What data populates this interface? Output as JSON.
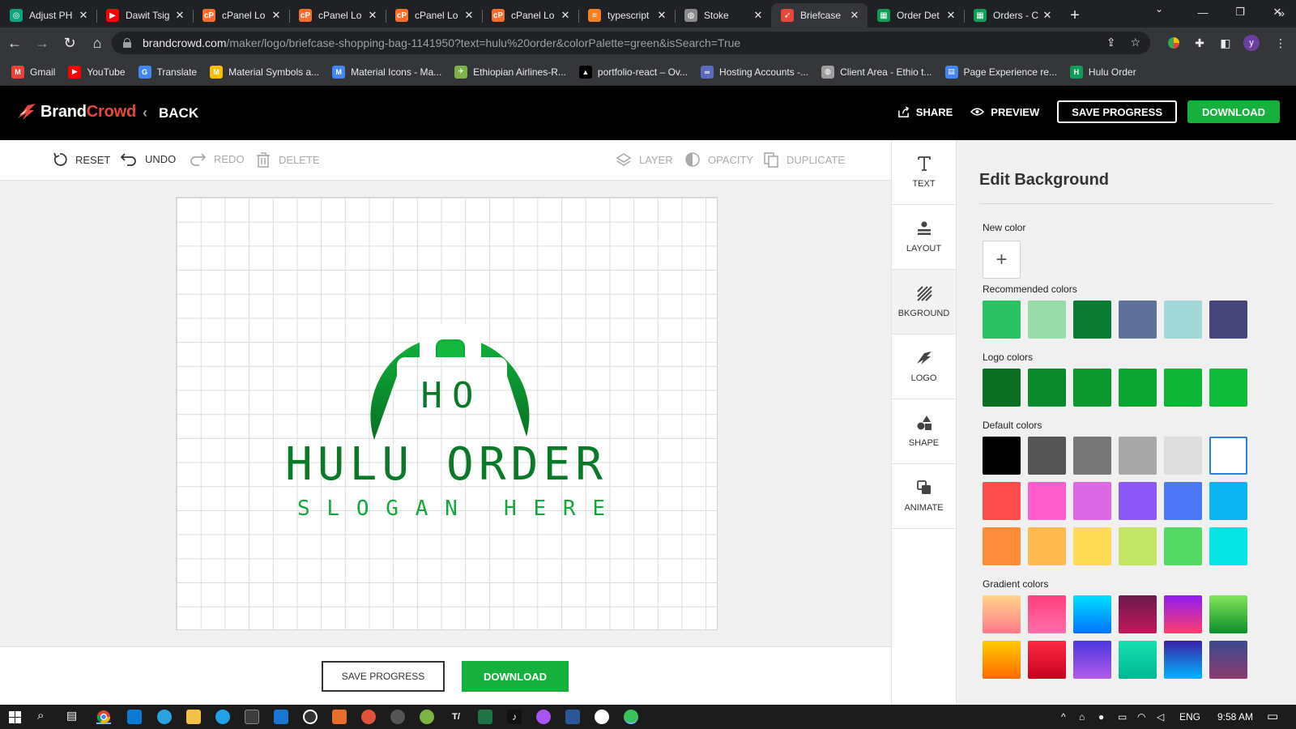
{
  "browser": {
    "tabs": [
      {
        "title": "Adjust PH",
        "color": "#10a37f",
        "glyph": "◎"
      },
      {
        "title": "Dawit Tsig",
        "color": "#ff0000",
        "glyph": "▶"
      },
      {
        "title": "cPanel Lo",
        "color": "#ff6c2c",
        "glyph": "cP"
      },
      {
        "title": "cPanel Lo",
        "color": "#ff6c2c",
        "glyph": "cP"
      },
      {
        "title": "cPanel Lo",
        "color": "#ff6c2c",
        "glyph": "cP"
      },
      {
        "title": "cPanel Lo",
        "color": "#ff6c2c",
        "glyph": "cP"
      },
      {
        "title": "typescript",
        "color": "#f48024",
        "glyph": "≡"
      },
      {
        "title": "Stoke",
        "color": "#8a8a8a",
        "glyph": "◍"
      },
      {
        "title": "Briefcase",
        "color": "#e8463b",
        "glyph": "➶"
      },
      {
        "title": "Order Det",
        "color": "#0f9d58",
        "glyph": "▦"
      },
      {
        "title": "Orders - C",
        "color": "#0f9d58",
        "glyph": "▦"
      }
    ],
    "active_tab_index": 8,
    "url_host": "brandcrowd.com",
    "url_path": "/maker/logo/briefcase-shopping-bag-1141950?text=hulu%20order&colorPalette=green&isSearch=True",
    "profile_initial": "y",
    "bookmarks": [
      {
        "label": "Gmail",
        "color": "#ea4335",
        "glyph": "M"
      },
      {
        "label": "YouTube",
        "color": "#ff0000",
        "glyph": "▶"
      },
      {
        "label": "Translate",
        "color": "#4285f4",
        "glyph": "G"
      },
      {
        "label": "Material Symbols a...",
        "color": "#fbbc04",
        "glyph": "M"
      },
      {
        "label": "Material Icons - Ma...",
        "color": "#4285f4",
        "glyph": "M"
      },
      {
        "label": "Ethiopian Airlines-R...",
        "color": "#7cb342",
        "glyph": "✈"
      },
      {
        "label": "portfolio-react – Ov...",
        "color": "#000000",
        "glyph": "▲"
      },
      {
        "label": "Hosting Accounts -...",
        "color": "#5c6bc0",
        "glyph": "∞"
      },
      {
        "label": "Client Area - Ethio t...",
        "color": "#9e9e9e",
        "glyph": "◍"
      },
      {
        "label": "Page Experience re...",
        "color": "#4285f4",
        "glyph": "▤"
      },
      {
        "label": "Hulu Order",
        "color": "#0f9d58",
        "glyph": "H"
      }
    ]
  },
  "header": {
    "brand_part1": "Brand",
    "brand_part2": "Crowd",
    "back_label": "BACK",
    "share_label": "SHARE",
    "preview_label": "PREVIEW",
    "save_progress_label": "SAVE PROGRESS",
    "download_label": "DOWNLOAD"
  },
  "toolbar": {
    "reset": "RESET",
    "undo": "UNDO",
    "redo": "REDO",
    "delete": "DELETE",
    "layer": "LAYER",
    "opacity": "OPACITY",
    "duplicate": "DUPLICATE"
  },
  "logo": {
    "monogram": "HO",
    "name": "HULU ORDER",
    "slogan": "SLOGAN HERE",
    "primary_color": "#0a7a2a",
    "accent_color": "#12b33e"
  },
  "bottom": {
    "save_progress_label": "SAVE PROGRESS",
    "download_label": "DOWNLOAD"
  },
  "side_tabs": [
    {
      "label": "TEXT",
      "icon": "text-icon"
    },
    {
      "label": "LAYOUT",
      "icon": "layout-icon"
    },
    {
      "label": "BKGROUND",
      "icon": "background-icon"
    },
    {
      "label": "LOGO",
      "icon": "logo-icon"
    },
    {
      "label": "SHAPE",
      "icon": "shape-icon"
    },
    {
      "label": "ANIMATE",
      "icon": "animate-icon"
    }
  ],
  "active_side_tab": "BKGROUND",
  "panel": {
    "title": "Edit Background",
    "new_color_label": "New color",
    "recommended_label": "Recommended colors",
    "recommended": [
      "#2ac265",
      "#98dcaa",
      "#0b7a32",
      "#5f7198",
      "#a3d8d8",
      "#45457a"
    ],
    "logo_colors_label": "Logo colors",
    "logo_colors": [
      "#0b6e22",
      "#0b8a2d",
      "#0c982f",
      "#0ca532",
      "#0db536",
      "#10bb3a"
    ],
    "default_colors_label": "Default colors",
    "default_colors": [
      [
        "#000000",
        "#555555",
        "#777777",
        "#a8a8a8",
        "#dddddd",
        "#ffffff"
      ],
      [
        "#ff4b4b",
        "#ff5ccc",
        "#dc68e5",
        "#8b57f6",
        "#4a76f7",
        "#0db4f4"
      ],
      [
        "#ff8c3a",
        "#ffba4f",
        "#ffdb55",
        "#c3e566",
        "#55d965",
        "#05e3e3"
      ]
    ],
    "selected_default": "#ffffff",
    "gradient_colors_label": "Gradient colors",
    "gradients": [
      [
        "linear-gradient(180deg,#ffd48a,#ff7a8a)",
        "linear-gradient(180deg,#ff3e7e,#ff6fa8)",
        "linear-gradient(180deg,#00e0ff,#0073ff)",
        "linear-gradient(180deg,#6a1a4c,#c2185b)",
        "linear-gradient(180deg,#8e1cf2,#ff3e6c)",
        "linear-gradient(180deg,#84e55a,#0b8d2a)"
      ],
      [
        "linear-gradient(180deg,#ffcb00,#ff6a00)",
        "linear-gradient(180deg,#ff2a45,#c7001d)",
        "linear-gradient(180deg,#4a36e0,#b35be8)",
        "linear-gradient(180deg,#17e0b0,#00b894)",
        "linear-gradient(180deg,#3b1fa6,#00b6ff)",
        "linear-gradient(180deg,#3b4a8c,#8a3b70)"
      ]
    ]
  },
  "taskbar": {
    "language": "ENG",
    "time": "9:58 AM"
  }
}
